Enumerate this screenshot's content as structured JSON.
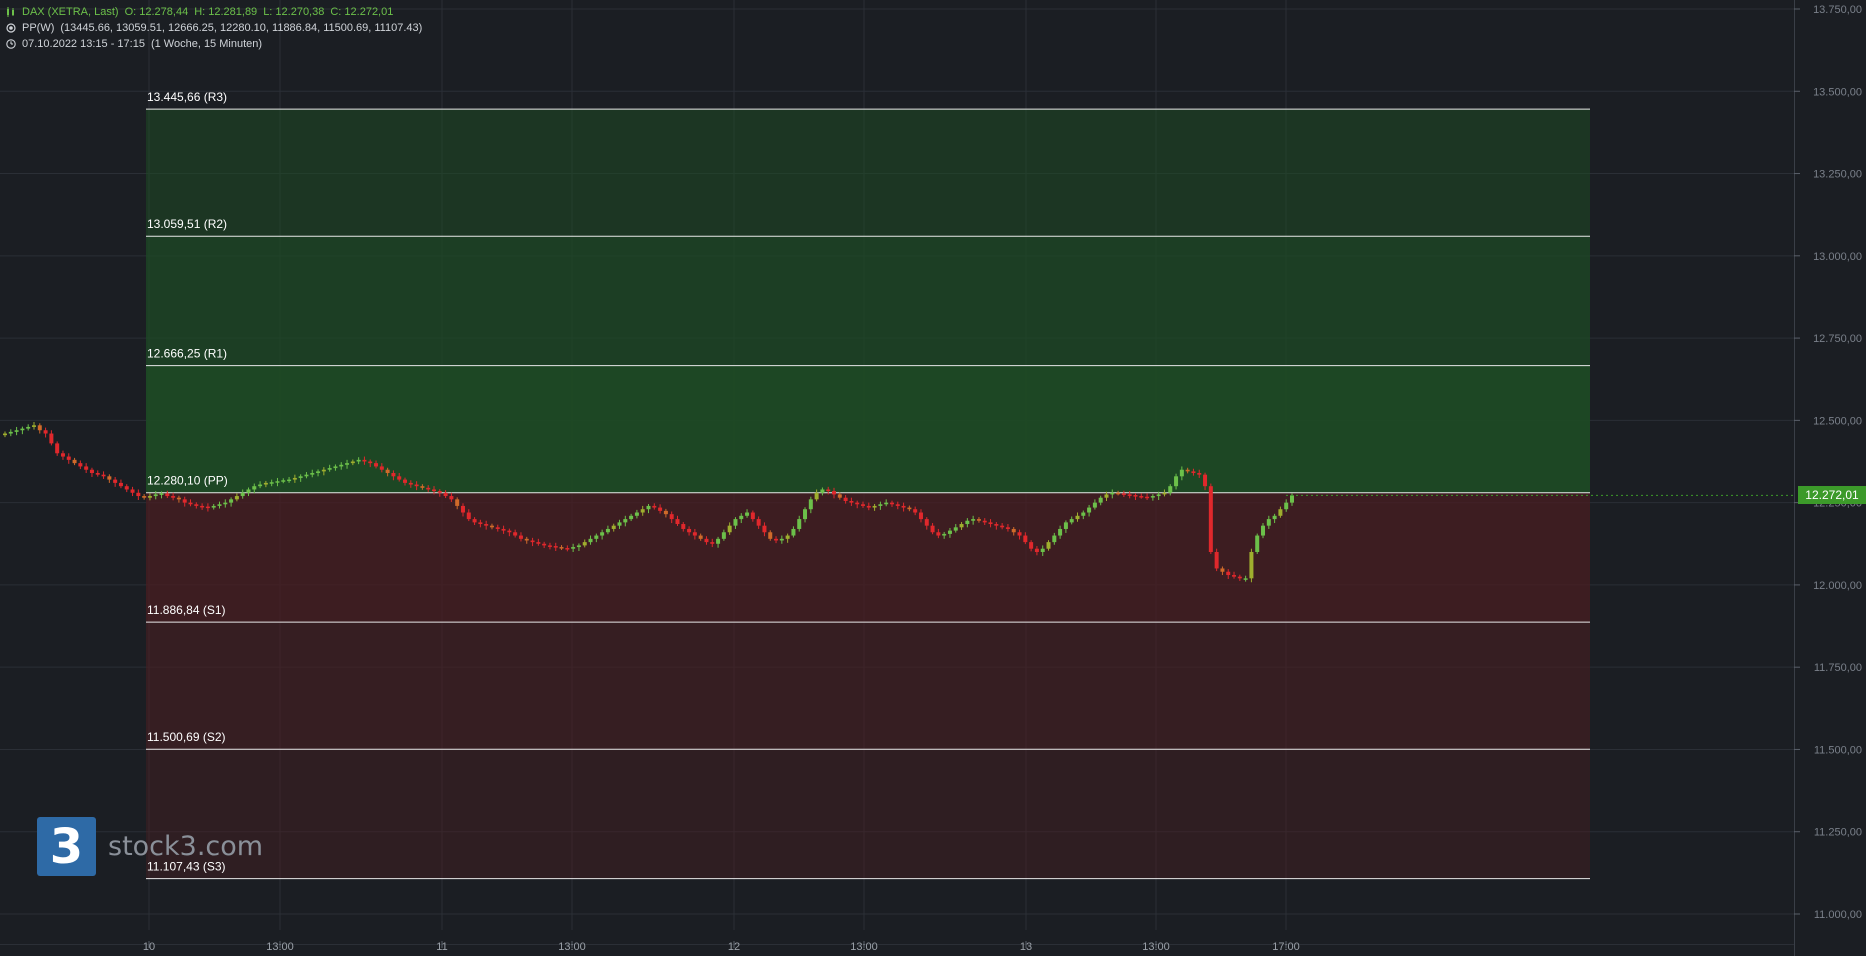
{
  "header": {
    "instrument": "DAX (XETRA, Last)",
    "open": "O: 12.278,44",
    "high": "H: 12.281,89",
    "low": "L: 12.270,38",
    "close": "C: 12.272,01",
    "indicator_name": "PP(W)",
    "indicator_values": "(13445.66, 13059.51, 12666.25, 12280.10, 11886.84, 11500.69, 11107.43)",
    "date_range": "07.10.2022 13:15 - 17:15",
    "timeframe": "(1 Woche, 15 Minuten)"
  },
  "logo": {
    "symbol": "3",
    "text": "stock3.com"
  },
  "price_label": "12.272,01",
  "colors": {
    "background": "#1b1e23",
    "bull": "#6cc04a",
    "bear": "#e0282c",
    "neutral": "#9fae2e",
    "zone_green": "#1a3a1e",
    "zone_red": "#3a1b1e",
    "price_tag": "#3c9a2a"
  },
  "chart_data": {
    "type": "candlestick",
    "title": "",
    "ylim": [
      10970,
      13780
    ],
    "y_ticks": [
      11000,
      11250,
      11500,
      11750,
      12000,
      12250,
      12500,
      12750,
      13000,
      13250,
      13500,
      13750
    ],
    "y_tick_labels": [
      "11.000,00",
      "11.250,00",
      "11.500,00",
      "11.750,00",
      "12.000,00",
      "12.250,00",
      "12.500,00",
      "12.750,00",
      "13.000,00",
      "13.250,00",
      "13.500,00",
      "13.750,00"
    ],
    "x_ticks": [
      {
        "label": "10",
        "t": 0
      },
      {
        "label": "13:00",
        "t": 1
      },
      {
        "label": "11",
        "t": 2
      },
      {
        "label": "13:00",
        "t": 3
      },
      {
        "label": "12",
        "t": 4
      },
      {
        "label": "13:00",
        "t": 5
      },
      {
        "label": "13",
        "t": 6
      },
      {
        "label": "13:00",
        "t": 7
      },
      {
        "label": "17:00",
        "t": 8
      }
    ],
    "pivot_levels": [
      {
        "name": "R3",
        "value": 13445.66,
        "label": "13.445,66 (R3)"
      },
      {
        "name": "R2",
        "value": 13059.51,
        "label": "13.059,51 (R2)"
      },
      {
        "name": "R1",
        "value": 12666.25,
        "label": "12.666,25 (R1)"
      },
      {
        "name": "PP",
        "value": 12280.1,
        "label": "12.280,10 (PP)"
      },
      {
        "name": "S1",
        "value": 11886.84,
        "label": "11.886,84 (S1)"
      },
      {
        "name": "S2",
        "value": 11500.69,
        "label": "11.500,69 (S2)"
      },
      {
        "name": "S3",
        "value": 11107.43,
        "label": "11.107,43 (S3)"
      }
    ],
    "last_price": 12272.01,
    "close_series": [
      12460,
      12465,
      12470,
      12475,
      12480,
      12485,
      12470,
      12460,
      12430,
      12400,
      12390,
      12380,
      12370,
      12360,
      12350,
      12340,
      12335,
      12330,
      12320,
      12310,
      12300,
      12290,
      12280,
      12270,
      12265,
      12270,
      12275,
      12278,
      12270,
      12265,
      12260,
      12250,
      12245,
      12240,
      12238,
      12235,
      12240,
      12245,
      12250,
      12260,
      12270,
      12280,
      12290,
      12300,
      12305,
      12310,
      12312,
      12315,
      12318,
      12320,
      12325,
      12330,
      12335,
      12340,
      12345,
      12350,
      12355,
      12360,
      12365,
      12370,
      12375,
      12380,
      12375,
      12370,
      12360,
      12350,
      12340,
      12330,
      12320,
      12310,
      12305,
      12300,
      12295,
      12290,
      12285,
      12280,
      12270,
      12260,
      12240,
      12220,
      12200,
      12190,
      12185,
      12180,
      12175,
      12170,
      12165,
      12160,
      12150,
      12140,
      12135,
      12130,
      12125,
      12120,
      12118,
      12115,
      12112,
      12110,
      12115,
      12120,
      12130,
      12140,
      12150,
      12160,
      12170,
      12180,
      12190,
      12200,
      12210,
      12220,
      12230,
      12240,
      12235,
      12225,
      12215,
      12200,
      12185,
      12170,
      12160,
      12150,
      12140,
      12130,
      12125,
      12140,
      12160,
      12180,
      12200,
      12210,
      12220,
      12200,
      12180,
      12160,
      12140,
      12135,
      12140,
      12150,
      12170,
      12200,
      12230,
      12260,
      12280,
      12290,
      12285,
      12275,
      12265,
      12255,
      12250,
      12245,
      12240,
      12235,
      12240,
      12245,
      12250,
      12245,
      12240,
      12235,
      12230,
      12220,
      12200,
      12180,
      12160,
      12150,
      12155,
      12165,
      12175,
      12185,
      12195,
      12200,
      12195,
      12190,
      12185,
      12180,
      12175,
      12170,
      12160,
      12150,
      12130,
      12110,
      12100,
      12110,
      12130,
      12150,
      12170,
      12190,
      12200,
      12210,
      12220,
      12235,
      12250,
      12265,
      12275,
      12280,
      12278,
      12275,
      12273,
      12270,
      12268,
      12266,
      12270,
      12275,
      12280,
      12300,
      12330,
      12350,
      12345,
      12340,
      12335,
      12300,
      12100,
      12050,
      12040,
      12030,
      12025,
      12020,
      12020,
      12100,
      12150,
      12180,
      12200,
      12210,
      12230,
      12250,
      12272
    ]
  }
}
